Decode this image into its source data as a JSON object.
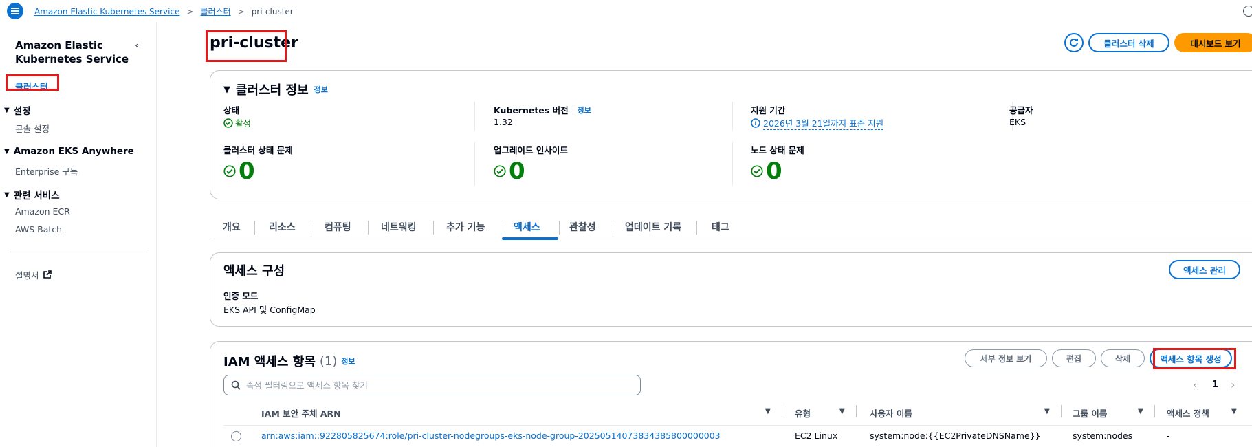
{
  "breadcrumb": {
    "service": "Amazon Elastic Kubernetes Service",
    "clusters": "클러스터",
    "current": "pri-cluster"
  },
  "sidebar": {
    "title": "Amazon Elastic Kubernetes Service",
    "active_item": "클러스터",
    "sections": [
      {
        "label": "설정",
        "items": [
          "콘솔 설정"
        ]
      },
      {
        "label": "Amazon EKS Anywhere",
        "items": [
          "Enterprise 구독"
        ]
      },
      {
        "label": "관련 서비스",
        "items": [
          "Amazon ECR",
          "AWS Batch"
        ]
      }
    ],
    "docs": "설명서"
  },
  "header": {
    "title": "pri-cluster",
    "delete_button": "클러스터 삭제",
    "dashboard_button": "대시보드 보기"
  },
  "cluster_info": {
    "heading": "클러스터 정보",
    "info": "정보",
    "status_label": "상태",
    "status_value": "활성",
    "k8s_label": "Kubernetes 버전",
    "k8s_info": "정보",
    "k8s_value": "1.32",
    "support_label": "지원 기간",
    "support_value": "2026년 3월 21일까지 표준 지원",
    "provider_label": "공급자",
    "provider_value": "EKS",
    "health_label": "클러스터 상태 문제",
    "health_value": "0",
    "upgrade_label": "업그레이드 인사이트",
    "upgrade_value": "0",
    "node_label": "노드 상태 문제",
    "node_value": "0"
  },
  "tabs": [
    "개요",
    "리소스",
    "컴퓨팅",
    "네트워킹",
    "추가 기능",
    "액세스",
    "관찰성",
    "업데이트 기록",
    "태그"
  ],
  "active_tab": "액세스",
  "access_config": {
    "heading": "액세스 구성",
    "manage_button": "액세스 관리",
    "auth_label": "인증 모드",
    "auth_value": "EKS API 및 ConfigMap"
  },
  "iam_entries": {
    "heading": "IAM 액세스 항목",
    "count": "(1)",
    "info": "정보",
    "details_button": "세부 정보 보기",
    "edit_button": "편집",
    "delete_button": "삭제",
    "create_button": "액세스 항목 생성",
    "search_placeholder": "속성 필터링으로 액세스 항목 찾기",
    "page": "1",
    "columns": [
      "IAM 보안 주체 ARN",
      "유형",
      "사용자 이름",
      "그룹 이름",
      "액세스 정책"
    ],
    "rows": [
      {
        "arn": "arn:aws:iam::922805825674:role/pri-cluster-nodegroups-eks-node-group-20250514073834385800000003",
        "type": "EC2 Linux",
        "username": "system:node:{{EC2PrivateDNSName}}",
        "group": "system:nodes",
        "policy": "-"
      }
    ]
  }
}
